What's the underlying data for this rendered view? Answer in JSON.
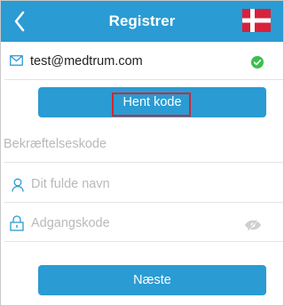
{
  "header": {
    "title": "Registrer",
    "back_icon": "chevron-left-icon",
    "flag_icon": "denmark-flag-icon",
    "color": "#2a9bd3"
  },
  "email": {
    "value": "test@medtrum.com",
    "icon": "mail-icon",
    "status_icon": "check-circle-icon",
    "status_color": "#3bbf4a"
  },
  "get_code_button": {
    "label": "Hent kode"
  },
  "fields": {
    "code": {
      "placeholder": "Bekræftelseskode"
    },
    "name": {
      "placeholder": "Dit fulde navn",
      "icon": "user-icon"
    },
    "password": {
      "placeholder": "Adgangskode",
      "icon": "lock-icon",
      "toggle_icon": "eye-hidden-icon"
    }
  },
  "next_button": {
    "label": "Næste"
  },
  "accent_color": "#2a9bd3",
  "highlight_color": "#d0282e"
}
